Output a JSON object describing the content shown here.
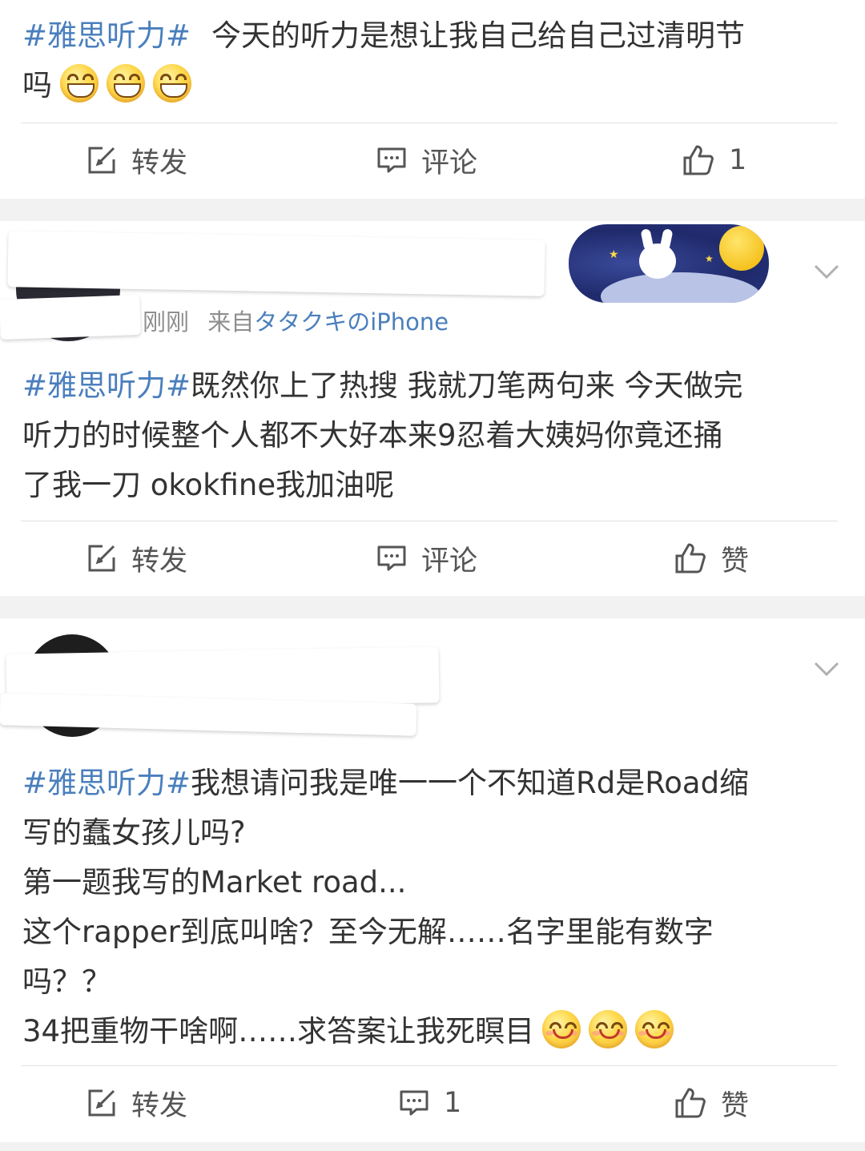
{
  "posts": [
    {
      "hashtag": "#雅思听力#",
      "lines": [
        "今天的听力是想让我自己给自己过清明节",
        "吗"
      ],
      "emojis": [
        "grin",
        "grin",
        "grin"
      ],
      "actions": {
        "repost": "转发",
        "comment": "评论",
        "like": "1"
      }
    },
    {
      "meta_time": "刚刚",
      "meta_source_prefix": "来自",
      "meta_source": "タタクキのiPhone",
      "hashtag": "#雅思听力#",
      "lines": [
        "既然你上了热搜 我就刀笔两句来 今天做完",
        "听力的时候整个人都不大好本来9忍着大姨妈你竟还捅",
        "了我一刀 okokfine我加油呢"
      ],
      "actions": {
        "repost": "转发",
        "comment": "评论",
        "like": "赞"
      }
    },
    {
      "hashtag": "#雅思听力#",
      "lines": [
        "我想请问我是唯一一个不知道Rd是Road缩",
        "写的蠢女孩儿吗?",
        "第一题我写的Market road...",
        "这个rapper到底叫啥？至今无解……名字里能有数字",
        "吗？？",
        "34把重物干啥啊……求答案让我死瞑目"
      ],
      "emojis": [
        "smile",
        "smile",
        "smile"
      ],
      "actions": {
        "repost": "转发",
        "comment": "1",
        "like": "赞"
      }
    }
  ],
  "icons": [
    "repost-icon",
    "comment-icon",
    "like-icon",
    "chevron-down-icon"
  ],
  "colors": {
    "hashtag": "#4a7fbd",
    "separator": "#f2f2f2",
    "text": "#333333"
  }
}
